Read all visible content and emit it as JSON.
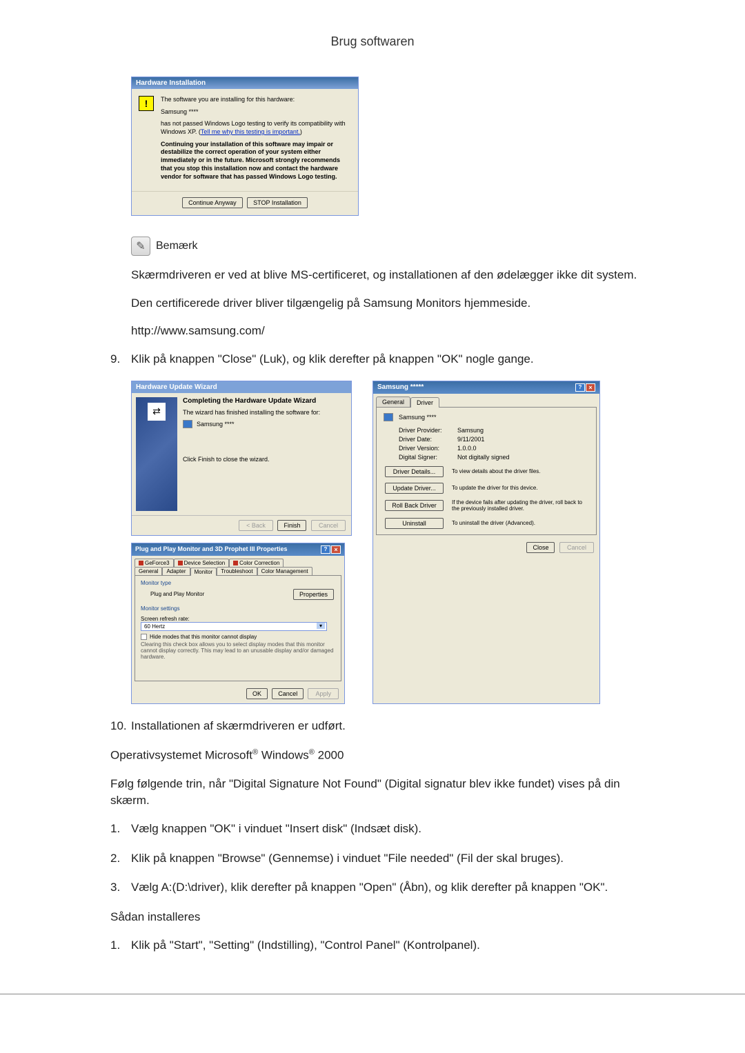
{
  "page_title": "Brug softwaren",
  "hw_install": {
    "title": "Hardware Installation",
    "line1": "The software you are installing for this hardware:",
    "device": "Samsung ****",
    "line2a": "has not passed Windows Logo testing to verify its compatibility with Windows XP. (",
    "link": "Tell me why this testing is important.",
    "line2b": ")",
    "warn": "Continuing your installation of this software may impair or destabilize the correct operation of your system either immediately or in the future. Microsoft strongly recommends that you stop this installation now and contact the hardware vendor for software that has passed Windows Logo testing.",
    "btn_continue": "Continue Anyway",
    "btn_stop": "STOP Installation"
  },
  "note_label": "Bemærk",
  "body1": "Skærmdriveren er ved at blive MS-certificeret, og installationen af den ødelægger ikke dit system.",
  "body2": "Den certificerede driver bliver tilgængelig på Samsung Monitors hjemmeside.",
  "body_url": "http://www.samsung.com/",
  "step9_num": "9.",
  "step9": "Klik på knappen \"Close\" (Luk), og klik derefter på knappen \"OK\" nogle gange.",
  "wizard": {
    "title": "Hardware Update Wizard",
    "heading": "Completing the Hardware Update Wizard",
    "line1": "The wizard has finished installing the software for:",
    "device": "Samsung ****",
    "line2": "Click Finish to close the wizard.",
    "btn_back": "< Back",
    "btn_finish": "Finish",
    "btn_cancel": "Cancel"
  },
  "driver_props": {
    "title": "Samsung *****",
    "tab_general": "General",
    "tab_driver": "Driver",
    "device": "Samsung ****",
    "rows": {
      "provider_label": "Driver Provider:",
      "provider_value": "Samsung",
      "date_label": "Driver Date:",
      "date_value": "9/11/2001",
      "version_label": "Driver Version:",
      "version_value": "1.0.0.0",
      "signer_label": "Digital Signer:",
      "signer_value": "Not digitally signed"
    },
    "buttons": {
      "details": "Driver Details...",
      "details_desc": "To view details about the driver files.",
      "update": "Update Driver...",
      "update_desc": "To update the driver for this device.",
      "rollback": "Roll Back Driver",
      "rollback_desc": "If the device fails after updating the driver, roll back to the previously installed driver.",
      "uninstall": "Uninstall",
      "uninstall_desc": "To uninstall the driver (Advanced)."
    },
    "btn_close": "Close",
    "btn_cancel": "Cancel"
  },
  "monitor_props": {
    "title": "Plug and Play Monitor and 3D Prophet III Properties",
    "tabs": {
      "geforce": "GeForce3",
      "devsel": "Device Selection",
      "colorcorr": "Color Correction",
      "general": "General",
      "adapter": "Adapter",
      "monitor": "Monitor",
      "troubleshoot": "Troubleshoot",
      "colormgmt": "Color Management"
    },
    "group1": "Monitor type",
    "monitor_type": "Plug and Play Monitor",
    "btn_properties": "Properties",
    "group2": "Monitor settings",
    "refresh_label": "Screen refresh rate:",
    "refresh_value": "60 Hertz",
    "hide_check": "Hide modes that this monitor cannot display",
    "hide_desc": "Clearing this check box allows you to select display modes that this monitor cannot display correctly. This may lead to an unusable display and/or damaged hardware.",
    "btn_ok": "OK",
    "btn_cancel": "Cancel",
    "btn_apply": "Apply"
  },
  "step10_num": "10.",
  "step10": "Installationen af skærmdriveren er udført.",
  "os_2000": "Operativsystemet Microsoft® Windows® 2000",
  "body3": "Følg følgende trin, når \"Digital Signature Not Found\" (Digital signatur blev ikke fundet) vises på din skærm.",
  "steps2000": [
    {
      "num": "1.",
      "text": "Vælg knappen \"OK\" i vinduet \"Insert disk\" (Indsæt disk)."
    },
    {
      "num": "2.",
      "text": "Klik på knappen \"Browse\" (Gennemse) i vinduet \"File needed\" (Fil der skal bruges)."
    },
    {
      "num": "3.",
      "text": "Vælg A:(D:\\driver), klik derefter på knappen \"Open\" (Åbn), og klik derefter på knappen \"OK\"."
    }
  ],
  "install_heading": "Sådan installeres",
  "install_step": {
    "num": "1.",
    "text": "Klik på \"Start\", \"Setting\" (Indstilling), \"Control Panel\" (Kontrolpanel)."
  }
}
